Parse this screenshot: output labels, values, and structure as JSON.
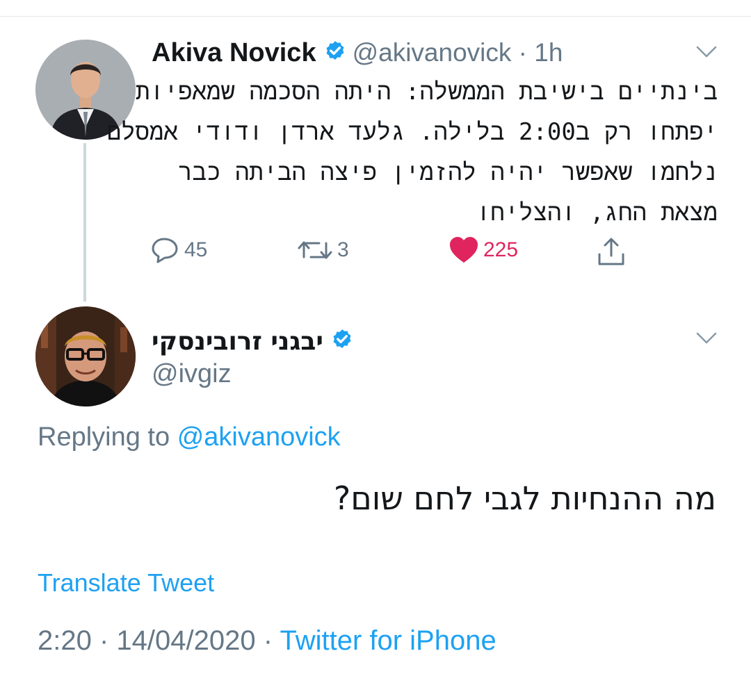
{
  "parent_tweet": {
    "author_name": "Akiva Novick",
    "handle": "@akivanovick",
    "time": "1h",
    "text_lines": [
      "בינתיים בישיבת הממשלה: היתה הסכמה שמאפיות",
      "יפתחו רק ב2:00 בלילה. גלעד ארדן ודודי אמסלם",
      "נלחמו שאפשר יהיה להזמין פיצה הביתה כבר",
      "מצאת החג, והצליחו"
    ],
    "stats": {
      "replies": "45",
      "retweets": "3",
      "likes": "225"
    }
  },
  "reply_tweet": {
    "author_name": "יבגני זרובינסקי",
    "handle": "@ivgiz",
    "replying_prefix": "Replying to",
    "replying_to": "@akivanovick",
    "text": "מה ההנחיות לגבי לחם שום?",
    "translate_label": "Translate Tweet",
    "time": "2:20",
    "date": "14/04/2020",
    "source": "Twitter for iPhone"
  },
  "icons": {
    "verified": "verified-badge-icon",
    "caret": "chevron-down-icon",
    "reply": "reply-icon",
    "retweet": "retweet-icon",
    "like": "heart-icon",
    "share": "share-icon"
  },
  "colors": {
    "accent": "#1da1f2",
    "like": "#e0245e",
    "muted": "#657786",
    "text": "#14171a"
  }
}
